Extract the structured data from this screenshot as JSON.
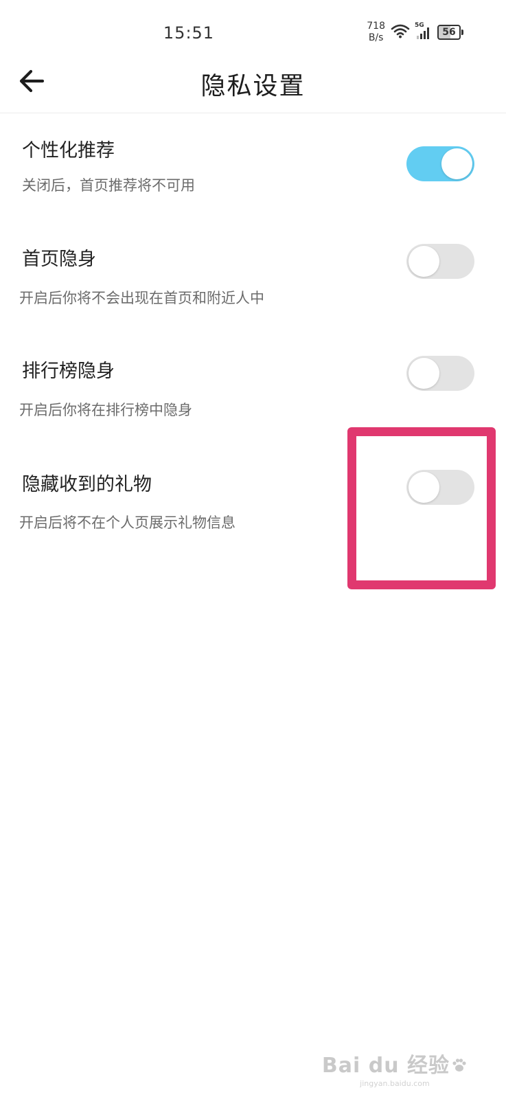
{
  "status_bar": {
    "time": "15:51",
    "net_speed_value": "718",
    "net_speed_unit": "B/s",
    "signal_label": "5G",
    "battery_level": "56",
    "wifi_icon": "wifi-icon",
    "signal_icon": "cellular-signal-icon",
    "battery_icon": "battery-icon"
  },
  "header": {
    "title": "隐私设置",
    "back_icon": "arrow-left-icon"
  },
  "settings": [
    {
      "title": "个性化推荐",
      "description": "关闭后，首页推荐将不可用",
      "enabled": true
    },
    {
      "title": "首页隐身",
      "description": "开启后你将不会出现在首页和附近人中",
      "enabled": false
    },
    {
      "title": "排行榜隐身",
      "description": "开启后你将在排行榜中隐身",
      "enabled": false
    },
    {
      "title": "隐藏收到的礼物",
      "description": "开启后将不在个人页展示礼物信息",
      "enabled": false
    }
  ],
  "colors": {
    "toggle_on": "#62cdf2",
    "toggle_off": "#e3e3e3",
    "highlight": "#e0386f"
  },
  "watermark": {
    "logo": "Bai du 经验",
    "url": "jingyan.baidu.com"
  }
}
